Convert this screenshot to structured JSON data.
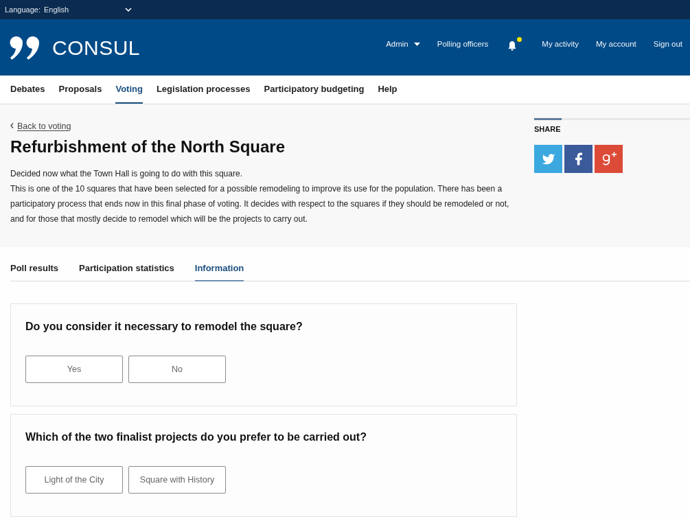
{
  "top_bar": {
    "language_label": "Language:",
    "language": "English"
  },
  "header": {
    "logo_text": "CONSUL",
    "user_menu": [
      {
        "kind": "dropdown",
        "label": "Admin"
      },
      {
        "kind": "link",
        "label": "Polling officers"
      },
      {
        "kind": "notifications",
        "unread": true
      },
      {
        "kind": "link",
        "label": "My activity"
      },
      {
        "kind": "link",
        "label": "My account"
      },
      {
        "kind": "link",
        "label": "Sign out"
      }
    ]
  },
  "main_nav": [
    {
      "label": "Debates",
      "selected": false
    },
    {
      "label": "Proposals",
      "selected": false
    },
    {
      "label": "Voting",
      "selected": true
    },
    {
      "label": "Legislation processes",
      "selected": false
    },
    {
      "label": "Participatory budgeting",
      "selected": false
    },
    {
      "label": "Help",
      "selected": false
    }
  ],
  "poll": {
    "back_link": "Back to voting",
    "title": "Refurbishment of the North Square",
    "description": [
      "Decided now what the Town Hall is going to do with this square.",
      "This is one of the 10 squares that have been selected for a possible remodeling to improve its use for the population. There has been a participatory process that ends now in this final phase of voting. It decides with respect to the squares if they should be remodeled or not, and for those that mostly decide to remodel which will be the projects to carry out."
    ]
  },
  "share": {
    "title": "SHARE",
    "buttons": [
      {
        "kind": "twitter"
      },
      {
        "kind": "facebook"
      },
      {
        "kind": "google_plus"
      }
    ]
  },
  "tabs": [
    {
      "label": "Poll results",
      "selected": false
    },
    {
      "label": "Participation statistics",
      "selected": false
    },
    {
      "label": "Information",
      "selected": true
    }
  ],
  "questions": [
    {
      "title": "Do you consider it necessary to remodel the square?",
      "answers": [
        "Yes",
        "No"
      ]
    },
    {
      "title": "Which of the two finalist projects do you prefer to be carried out?",
      "answers": [
        "Light of the City",
        "Square with History"
      ]
    }
  ]
}
